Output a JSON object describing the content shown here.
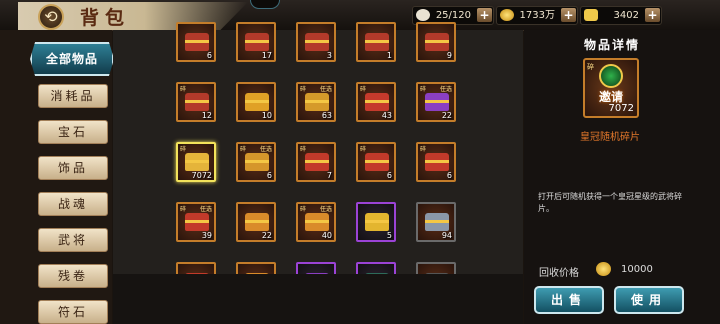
{
  "header": {
    "title": "背包",
    "back_glyph": "⟲"
  },
  "resources": [
    {
      "name": "bag-capacity",
      "value": "25/120",
      "color": "#e9e2d2"
    },
    {
      "name": "silver",
      "value": "1733万",
      "color": "#f2c22f"
    },
    {
      "name": "gold-ingot",
      "value": "3402",
      "color": "#f0c94a"
    }
  ],
  "plus_label": "+",
  "tabs": [
    {
      "label": "全部物品",
      "active": true
    },
    {
      "label": "消耗品"
    },
    {
      "label": "宝石"
    },
    {
      "label": "饰品"
    },
    {
      "label": "战魂"
    },
    {
      "label": "武将"
    },
    {
      "label": "残卷"
    },
    {
      "label": "符石"
    }
  ],
  "items": [
    {
      "count": "6",
      "tag": "",
      "tag2": "",
      "color": "#b33a2a"
    },
    {
      "count": "17",
      "tag": "",
      "tag2": "",
      "color": "#b33a2a"
    },
    {
      "count": "3",
      "tag": "",
      "tag2": "",
      "color": "#b33a2a"
    },
    {
      "count": "1",
      "tag": "",
      "tag2": "",
      "color": "#b33a2a"
    },
    {
      "count": "9",
      "tag": "",
      "tag2": "",
      "color": "#b33a2a"
    },
    {
      "count": "12",
      "tag": "碎",
      "tag2": "",
      "color": "#b33a2a"
    },
    {
      "count": "10",
      "tag": "",
      "tag2": "",
      "color": "#e0a126"
    },
    {
      "count": "63",
      "tag": "碎",
      "tag2": "任选",
      "color": "#d59a2a"
    },
    {
      "count": "43",
      "tag": "碎",
      "tag2": "",
      "color": "#c53a2c"
    },
    {
      "count": "22",
      "tag": "碎",
      "tag2": "任选",
      "color": "#8a3fc2"
    },
    {
      "count": "7072",
      "tag": "碎",
      "tag2": "",
      "color": "#e5b43a",
      "selected": true
    },
    {
      "count": "6",
      "tag": "碎",
      "tag2": "任选",
      "color": "#d5962b"
    },
    {
      "count": "7",
      "tag": "碎",
      "tag2": "",
      "color": "#c23a2a"
    },
    {
      "count": "6",
      "tag": "碎",
      "tag2": "",
      "color": "#c23a2a"
    },
    {
      "count": "6",
      "tag": "碎",
      "tag2": "",
      "color": "#c23a2a"
    },
    {
      "count": "39",
      "tag": "碎",
      "tag2": "任选",
      "color": "#c23a2a"
    },
    {
      "count": "22",
      "tag": "",
      "tag2": "",
      "color": "#d98b2a"
    },
    {
      "count": "40",
      "tag": "碎",
      "tag2": "任选",
      "color": "#d98b2a"
    },
    {
      "count": "5",
      "tag": "",
      "tag2": "",
      "color": "#e3b52f",
      "purple": true
    },
    {
      "count": "94",
      "tag": "",
      "tag2": "",
      "color": "#8a97a8",
      "gray": true
    },
    {
      "count": "",
      "tag": "",
      "tag2": "",
      "color": "#c23a2a"
    },
    {
      "count": "",
      "tag": "",
      "tag2": "",
      "color": "#d98b2a"
    },
    {
      "count": "",
      "tag": "",
      "tag2": "",
      "color": "#8a3fc2",
      "purple": true
    },
    {
      "count": "",
      "tag": "",
      "tag2": "",
      "color": "#2d6b5a",
      "purple": true
    },
    {
      "count": "",
      "tag": "",
      "tag2": "",
      "color": "#555",
      "gray": true
    }
  ],
  "detail": {
    "title": "物品详情",
    "tag": "碎",
    "icon_text": "邀请",
    "count": "7072",
    "name": "皇冠随机碎片",
    "description": "打开后可随机获得一个皇冠星级的武将碎片。",
    "price_label": "回收价格",
    "price_value": "10000",
    "sell_label": "出售",
    "use_label": "使用"
  }
}
